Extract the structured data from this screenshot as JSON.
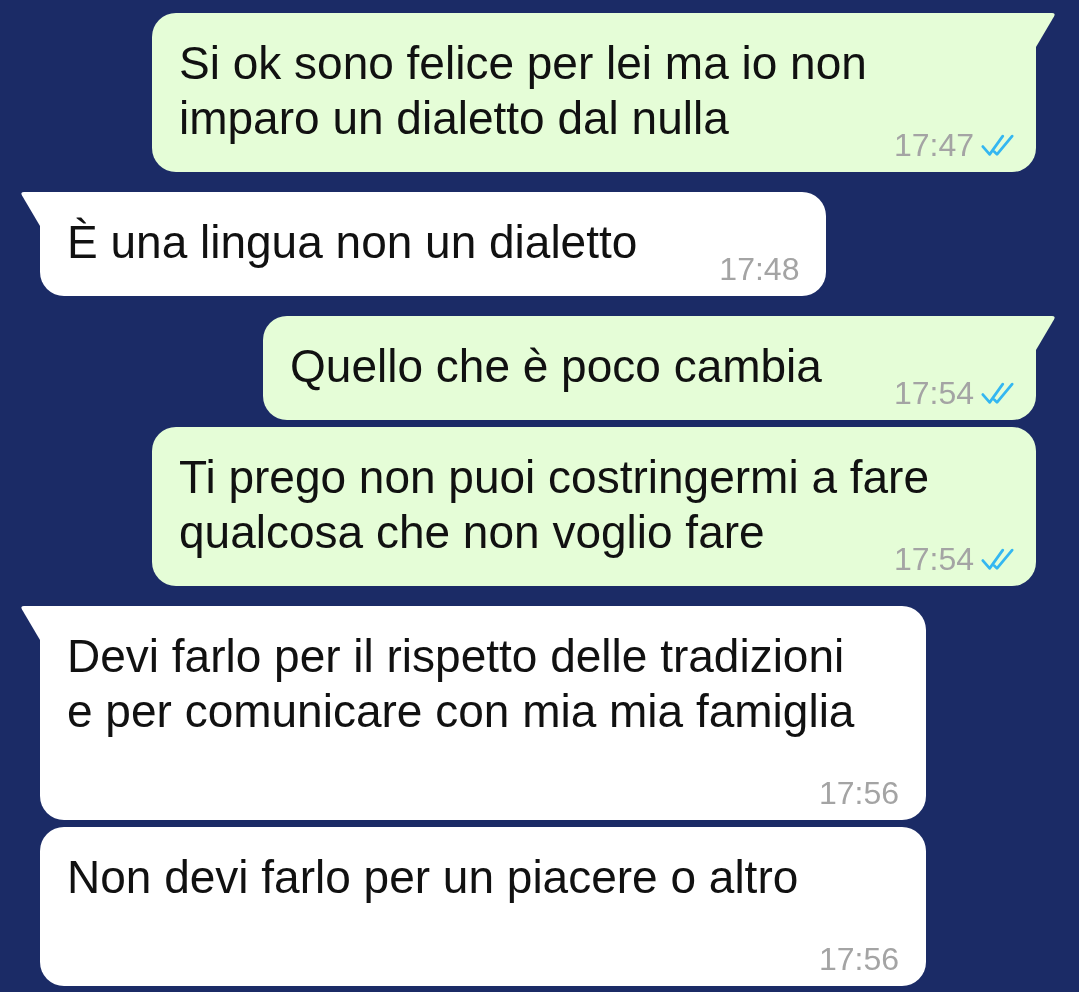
{
  "messages": [
    {
      "kind": "outgoing",
      "tail": true,
      "text": "Si ok sono felice per lei ma io non\nimparo un dialetto dal nulla",
      "time": "17:47",
      "read": true
    },
    {
      "kind": "incoming",
      "tail": true,
      "text": "È una lingua non un dialetto",
      "time": "17:48"
    },
    {
      "kind": "outgoing",
      "tail": true,
      "text": "Quello che è poco cambia",
      "time": "17:54",
      "read": true
    },
    {
      "kind": "outgoing",
      "tail": false,
      "text": "Ti prego non puoi costringermi a fare\nqualcosa che non voglio fare",
      "time": "17:54",
      "read": true
    },
    {
      "kind": "incoming",
      "tail": true,
      "text": "Devi farlo per il rispetto delle tradizioni\ne per comunicare con mia mia famiglia",
      "time": "17:56"
    },
    {
      "kind": "incoming",
      "tail": false,
      "text": "Non devi farlo per un piacere o altro",
      "time": "17:56"
    }
  ]
}
